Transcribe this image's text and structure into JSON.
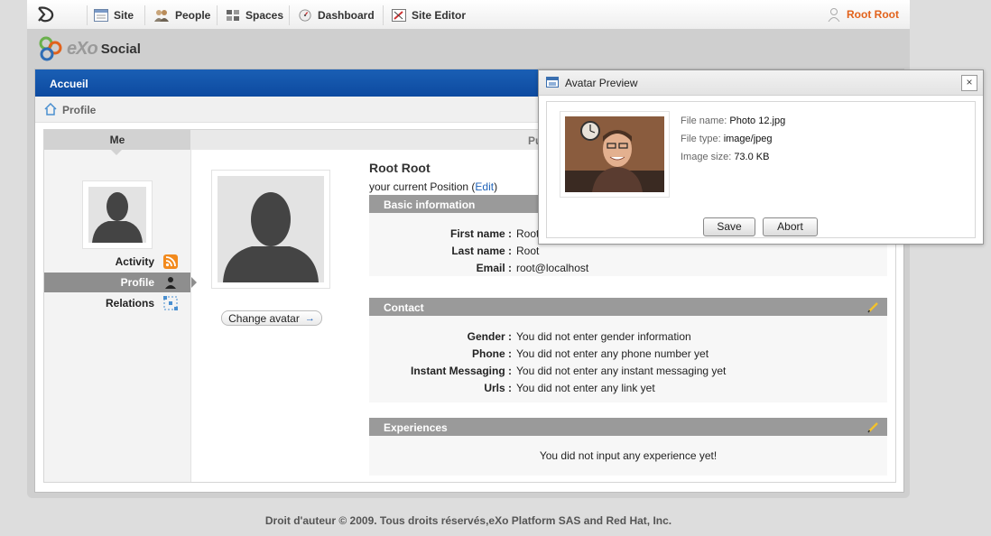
{
  "topbar": {
    "items": [
      {
        "label": "Site"
      },
      {
        "label": "People"
      },
      {
        "label": "Spaces"
      },
      {
        "label": "Dashboard"
      },
      {
        "label": "Site Editor"
      }
    ],
    "user": "Root Root"
  },
  "brand": {
    "exo": "eXo",
    "social": "Social"
  },
  "portal": {
    "section": "Accueil",
    "breadcrumb": "Profile"
  },
  "sidebar": {
    "header": "Me",
    "items": [
      {
        "label": "Activity"
      },
      {
        "label": "Profile"
      },
      {
        "label": "Relations"
      }
    ]
  },
  "public_header": "Pu",
  "profile": {
    "name": "Root Root",
    "position_text": "your current Position (",
    "edit_label": "Edit",
    "position_close": ")",
    "change_avatar": "Change avatar",
    "basic": {
      "title": "Basic information",
      "fields": [
        {
          "k": "First name :",
          "v": "Root"
        },
        {
          "k": "Last name :",
          "v": "Root"
        },
        {
          "k": "Email :",
          "v": "root@localhost"
        }
      ]
    },
    "contact": {
      "title": "Contact",
      "fields": [
        {
          "k": "Gender :",
          "v": "You did not enter gender information"
        },
        {
          "k": "Phone :",
          "v": "You did not enter any phone number yet"
        },
        {
          "k": "Instant Messaging :",
          "v": "You did not enter any instant messaging yet"
        },
        {
          "k": "Urls :",
          "v": "You did not enter any link yet"
        }
      ]
    },
    "experiences": {
      "title": "Experiences",
      "empty": "You did not input any experience yet!"
    }
  },
  "dialog": {
    "title": "Avatar Preview",
    "close": "×",
    "file_name_label": "File name:",
    "file_name": "Photo 12.jpg",
    "file_type_label": "File type:",
    "file_type": "image/jpeg",
    "image_size_label": "Image size:",
    "image_size": "73.0 KB",
    "save": "Save",
    "abort": "Abort"
  },
  "footer": "Droit d'auteur © 2009. Tous droits réservés,eXo Platform SAS and Red Hat, Inc."
}
